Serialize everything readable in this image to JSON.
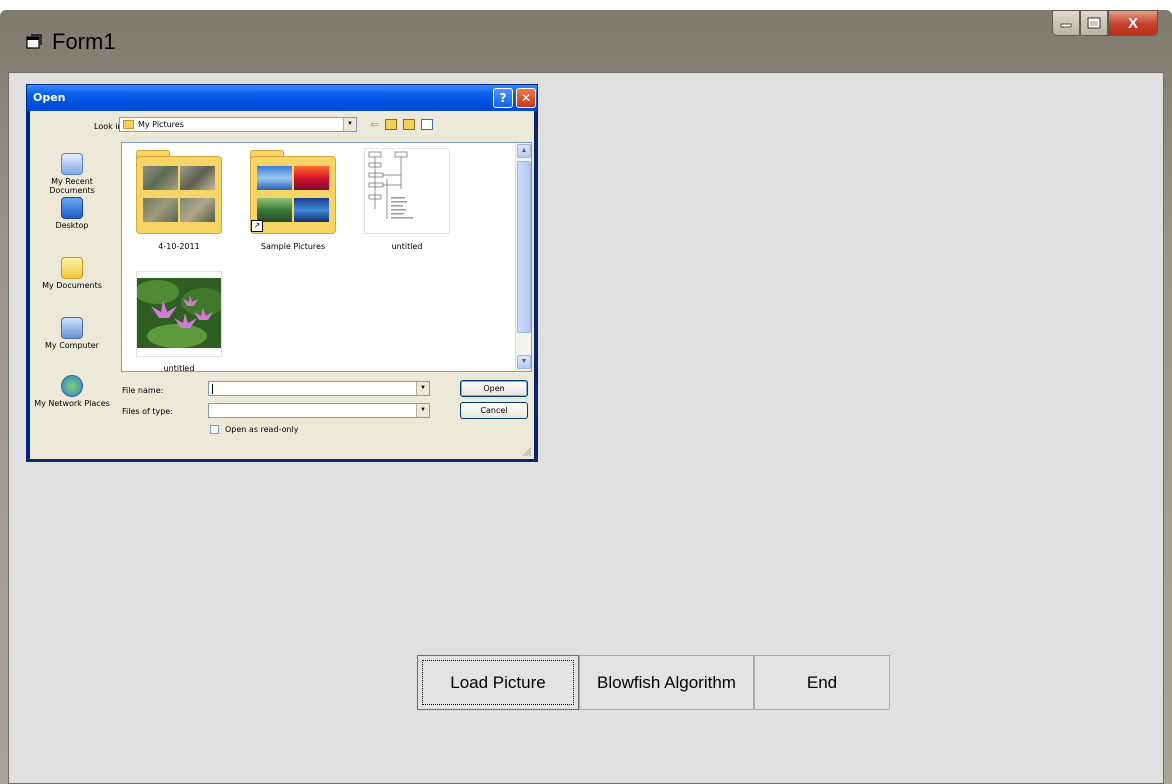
{
  "window": {
    "title": "Form1",
    "close_glyph": "X"
  },
  "open_dialog": {
    "title": "Open",
    "help_glyph": "?",
    "close_glyph": "✕",
    "look_in_label": "Look in:",
    "look_in_value": "My Pictures",
    "places": [
      "My Recent Documents",
      "Desktop",
      "My Documents",
      "My Computer",
      "My Network Places"
    ],
    "files": [
      {
        "name": "4-10-2011",
        "kind": "folder"
      },
      {
        "name": "Sample Pictures",
        "kind": "folder-shortcut"
      },
      {
        "name": "untitled",
        "kind": "diagram-image"
      },
      {
        "name": "untitled",
        "kind": "flower-image"
      }
    ],
    "file_name_label": "File name:",
    "file_name_value": "",
    "files_of_type_label": "Files of type:",
    "files_of_type_value": "",
    "open_button": "Open",
    "cancel_button": "Cancel",
    "read_only_label": "Open as read-only"
  },
  "buttons": {
    "load_picture": "Load Picture",
    "blowfish": "Blowfish Algorithm",
    "end": "End"
  },
  "colors": {
    "xp_title_blue": "#0050e0",
    "form_background": "#e0e0e0",
    "close_red": "#c2412a"
  }
}
